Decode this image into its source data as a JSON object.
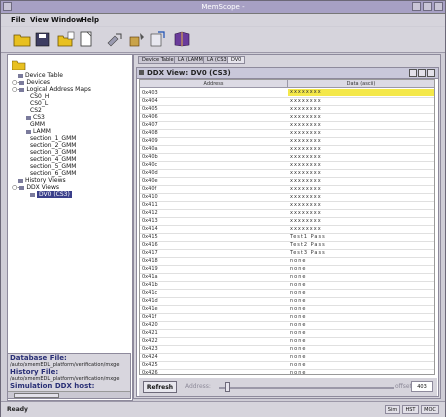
{
  "window": {
    "title": "MemScope -"
  },
  "menu": [
    "File",
    "View",
    "Window",
    "Help"
  ],
  "tree": {
    "items": [
      {
        "label": "Device Table"
      },
      {
        "label": "Devices"
      },
      {
        "label": "Logical Address Maps"
      },
      {
        "label": "CS0_H"
      },
      {
        "label": "CS0_L"
      },
      {
        "label": "CS2"
      },
      {
        "label": "CS3"
      },
      {
        "label": "GMM"
      },
      {
        "label": "LAMM"
      },
      {
        "label": "section_1_GMM"
      },
      {
        "label": "section_2_GMM"
      },
      {
        "label": "section_3_GMM"
      },
      {
        "label": "section_4_GMM"
      },
      {
        "label": "section_5_GMM"
      },
      {
        "label": "section_6_GMM"
      },
      {
        "label": "History Views"
      },
      {
        "label": "DDX Views"
      },
      {
        "label": "DV0 (CS3)"
      }
    ]
  },
  "left_bottom": {
    "database_label": "Database File:",
    "database_path": "/auto/xmemEDL_platform/verification/mxge",
    "history_label": "History File:",
    "history_path": "/auto/xmemEDL_platform/verification/mxge",
    "host_label": "Simulation DDX host:"
  },
  "tabs": [
    "Device Table",
    "LA (LAMM)",
    "LA (CS3)",
    "DV0"
  ],
  "ddx_view": {
    "title": "DDX View: DV0 (CS3)",
    "columns": [
      "Address",
      "Data (ascii)"
    ],
    "rows": [
      {
        "address": "0x403",
        "data": "xxxxxxxx",
        "selected": true
      },
      {
        "address": "0x404",
        "data": "xxxxxxxx"
      },
      {
        "address": "0x405",
        "data": "xxxxxxxx"
      },
      {
        "address": "0x406",
        "data": "xxxxxxxx"
      },
      {
        "address": "0x407",
        "data": "xxxxxxxx"
      },
      {
        "address": "0x408",
        "data": "xxxxxxxx"
      },
      {
        "address": "0x409",
        "data": "xxxxxxxx"
      },
      {
        "address": "0x40a",
        "data": "xxxxxxxx"
      },
      {
        "address": "0x40b",
        "data": "xxxxxxxx"
      },
      {
        "address": "0x40c",
        "data": "xxxxxxxx"
      },
      {
        "address": "0x40d",
        "data": "xxxxxxxx"
      },
      {
        "address": "0x40e",
        "data": "xxxxxxxx"
      },
      {
        "address": "0x40f",
        "data": "xxxxxxxx"
      },
      {
        "address": "0x410",
        "data": "xxxxxxxx"
      },
      {
        "address": "0x411",
        "data": "xxxxxxxx"
      },
      {
        "address": "0x412",
        "data": "xxxxxxxx"
      },
      {
        "address": "0x413",
        "data": "xxxxxxxx"
      },
      {
        "address": "0x414",
        "data": "xxxxxxxx"
      },
      {
        "address": "0x415",
        "data": "Test1 Pass"
      },
      {
        "address": "0x416",
        "data": "Test2 Pass"
      },
      {
        "address": "0x417",
        "data": "Test3 Pass"
      },
      {
        "address": "0x418",
        "data": "none"
      },
      {
        "address": "0x419",
        "data": "none"
      },
      {
        "address": "0x41a",
        "data": "none"
      },
      {
        "address": "0x41b",
        "data": "none"
      },
      {
        "address": "0x41c",
        "data": "none"
      },
      {
        "address": "0x41d",
        "data": "none"
      },
      {
        "address": "0x41e",
        "data": "none"
      },
      {
        "address": "0x41f",
        "data": "none"
      },
      {
        "address": "0x420",
        "data": "none"
      },
      {
        "address": "0x421",
        "data": "none"
      },
      {
        "address": "0x422",
        "data": "none"
      },
      {
        "address": "0x423",
        "data": "none"
      },
      {
        "address": "0x424",
        "data": "none"
      },
      {
        "address": "0x425",
        "data": "none"
      },
      {
        "address": "0x426",
        "data": "none"
      }
    ],
    "refresh_label": "Refresh",
    "address_label": "Address:",
    "offset_label": "offset:",
    "offset_value": "403"
  },
  "status": {
    "text": "Ready",
    "boxes": [
      "Sim",
      "HST",
      "MOC"
    ]
  },
  "colors": {
    "titlebar": "#a7a0c4",
    "selected_row": "#f4e84a",
    "tree_selection": "#3a3f8a"
  }
}
